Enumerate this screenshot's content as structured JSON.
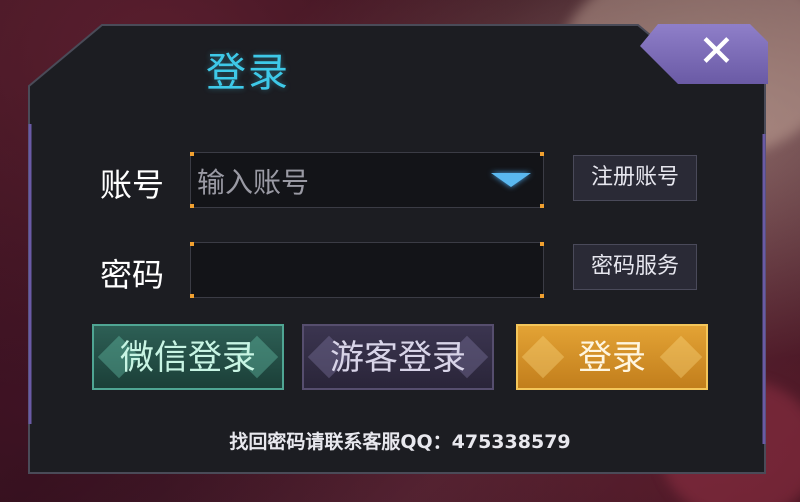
{
  "dialog": {
    "title": "登录",
    "close_label": "✕"
  },
  "account": {
    "label": "账号",
    "placeholder": "输入账号",
    "value": ""
  },
  "password": {
    "label": "密码",
    "value": ""
  },
  "side_buttons": {
    "register": "注册账号",
    "password_service": "密码服务"
  },
  "action_buttons": {
    "wechat": "微信登录",
    "guest": "游客登录",
    "login": "登录"
  },
  "footer": {
    "text": "找回密码请联系客服QQ：475338579"
  },
  "colors": {
    "title": "#3ec9e8",
    "panel": "#1c1d22",
    "close": "#8f7fc9",
    "wechat": "#2d5f55",
    "guest": "#3b3550",
    "login": "#e3a335",
    "input_corner": "#f0a030"
  },
  "icons": {
    "close": "close-icon",
    "dropdown": "chevron-down-icon"
  }
}
